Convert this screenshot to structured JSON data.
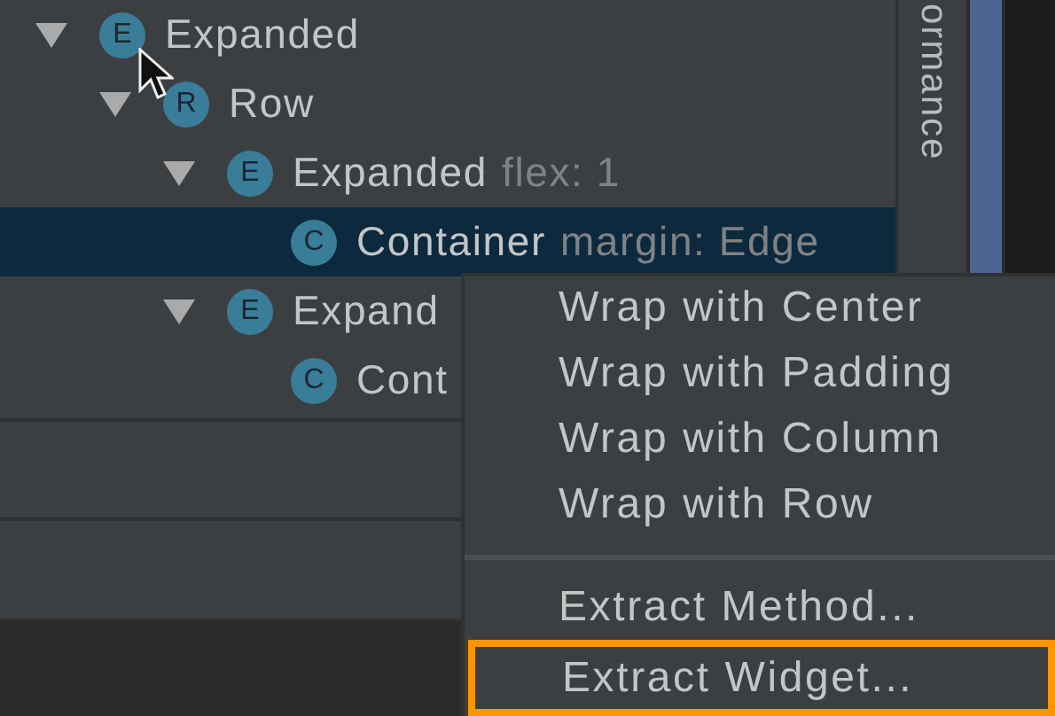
{
  "tree": [
    {
      "badge": "E",
      "label": "Expanded",
      "expanded": true,
      "selected": false,
      "children": [
        {
          "badge": "R",
          "label": "Row",
          "expanded": true,
          "selected": false,
          "children": [
            {
              "badge": "E",
              "label": "Expanded",
              "detail": "flex: 1",
              "expanded": true,
              "selected": false,
              "children": [
                {
                  "badge": "C",
                  "label": "Container",
                  "detail": "margin: Edge",
                  "selected": true
                }
              ]
            },
            {
              "badge": "E",
              "label": "Expand",
              "expanded": true,
              "selected": false,
              "children": [
                {
                  "badge": "C",
                  "label": "Cont",
                  "selected": false
                }
              ]
            }
          ]
        }
      ]
    }
  ],
  "side_tab": {
    "label": "ormance"
  },
  "context_menu": {
    "groups": [
      [
        {
          "label": "Wrap with Center",
          "selected": false
        },
        {
          "label": "Wrap with Padding",
          "selected": false
        },
        {
          "label": "Wrap with Column",
          "selected": false
        },
        {
          "label": "Wrap with Row",
          "selected": false
        }
      ],
      [
        {
          "label": "Extract Method...",
          "selected": false
        },
        {
          "label": "Extract Widget...",
          "selected": true
        }
      ]
    ]
  }
}
